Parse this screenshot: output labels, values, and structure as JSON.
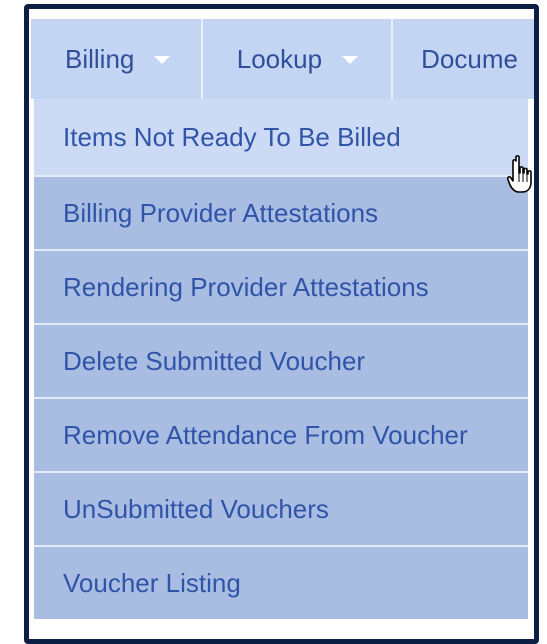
{
  "menubar": {
    "tabs": [
      {
        "label": "Billing",
        "has_caret": true
      },
      {
        "label": "Lookup",
        "has_caret": true
      },
      {
        "label": "Docume",
        "has_caret": false
      }
    ]
  },
  "dropdown": {
    "items": [
      {
        "label": "Items Not Ready To Be Billed",
        "hovered": true
      },
      {
        "label": "Billing Provider Attestations"
      },
      {
        "label": "Rendering Provider Attestations"
      },
      {
        "label": "Delete Submitted Voucher"
      },
      {
        "label": "Remove Attendance From Voucher"
      },
      {
        "label": "UnSubmitted Vouchers"
      },
      {
        "label": "Voucher Listing"
      }
    ]
  },
  "colors": {
    "frame": "#0b1f44",
    "menubar": "#c4d5f4",
    "dropdown": "#a9bde3",
    "hover": "#ccdaf5",
    "text": "#2f54a8"
  },
  "icons": {
    "caret": "caret-down-icon",
    "pointer": "hand-pointer-icon"
  }
}
